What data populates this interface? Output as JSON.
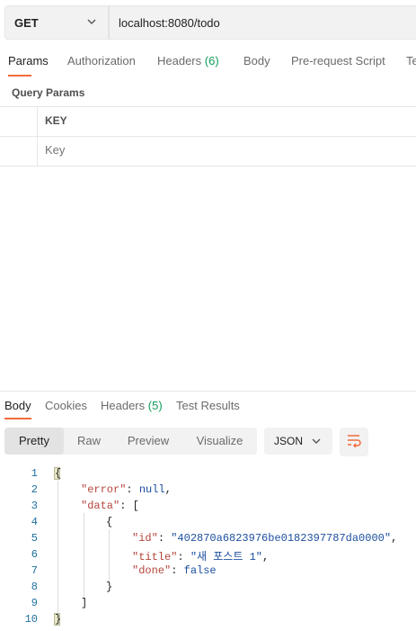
{
  "request": {
    "method": "GET",
    "url": "localhost:8080/todo"
  },
  "request_tabs": [
    {
      "label": "Params",
      "active": true
    },
    {
      "label": "Authorization"
    },
    {
      "label": "Headers",
      "count": "(6)"
    },
    {
      "label": "Body"
    },
    {
      "label": "Pre-request Script"
    },
    {
      "label": "Te"
    }
  ],
  "query_params": {
    "title": "Query Params",
    "column_key": "KEY",
    "key_placeholder": "Key"
  },
  "response_tabs": [
    {
      "label": "Body",
      "active": true
    },
    {
      "label": "Cookies"
    },
    {
      "label": "Headers",
      "count": "(5)"
    },
    {
      "label": "Test Results"
    }
  ],
  "view_modes": [
    "Pretty",
    "Raw",
    "Preview",
    "Visualize"
  ],
  "active_view": "Pretty",
  "format": "JSON",
  "icons": {
    "method_dropdown": "chevron-down-icon",
    "format_dropdown": "chevron-down-icon",
    "wrap": "wrap-lines-icon"
  },
  "colors": {
    "accent": "#f26b3a",
    "count": "#0f9d58",
    "json_key": "#b5443a",
    "json_value": "#1d4fa0"
  },
  "response_body": {
    "line_numbers": [
      "1",
      "2",
      "3",
      "4",
      "5",
      "6",
      "7",
      "8",
      "9",
      "10"
    ],
    "lines": {
      "l1_open": "{",
      "l2_key": "\"error\"",
      "l2_value": "null",
      "l3_key": "\"data\"",
      "l3_open": "[",
      "l4_open": "{",
      "l5_key": "\"id\"",
      "l5_value": "\"402870a6823976be0182397787da0000\"",
      "l6_key": "\"title\"",
      "l6_value": "\"새 포스트 1\"",
      "l7_key": "\"done\"",
      "l7_value": "false",
      "l8_close": "}",
      "l9_close": "]",
      "l10_close": "}"
    }
  }
}
